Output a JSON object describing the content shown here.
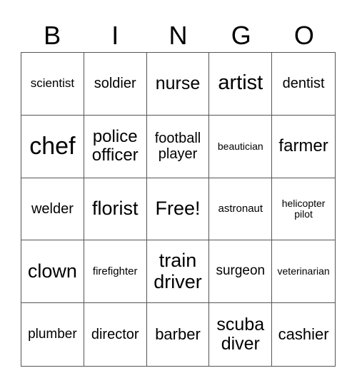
{
  "header": [
    "B",
    "I",
    "N",
    "G",
    "O"
  ],
  "cells": [
    "scientist",
    "soldier",
    "nurse",
    "artist",
    "dentist",
    "chef",
    "police officer",
    "football player",
    "beautician",
    "farmer",
    "welder",
    "florist",
    "Free!",
    "astronaut",
    "helicopter pilot",
    "clown",
    "firefighter",
    "train driver",
    "surgeon",
    "veterinarian",
    "plumber",
    "director",
    "barber",
    "scuba diver",
    "cashier"
  ]
}
